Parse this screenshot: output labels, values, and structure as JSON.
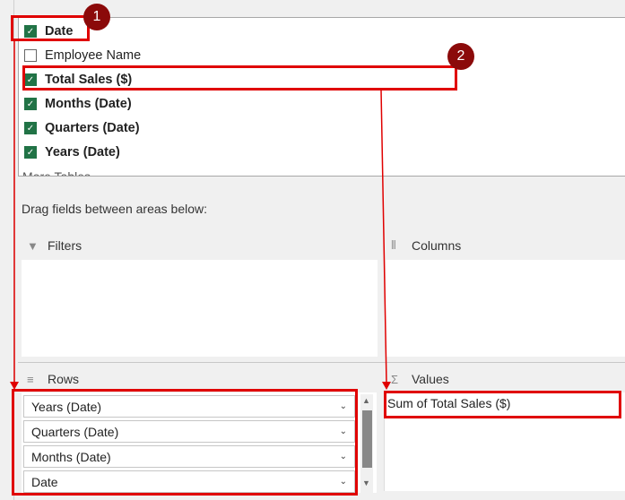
{
  "fields": [
    {
      "label": "Date",
      "checked": true
    },
    {
      "label": "Employee Name",
      "checked": false
    },
    {
      "label": "Total Sales ($)",
      "checked": true
    },
    {
      "label": "Months (Date)",
      "checked": true
    },
    {
      "label": "Quarters (Date)",
      "checked": true
    },
    {
      "label": "Years (Date)",
      "checked": true
    }
  ],
  "more_tables": "More Tables...",
  "drag_hint": "Drag fields between areas below:",
  "areas": {
    "filters": "Filters",
    "columns": "Columns",
    "rows": "Rows",
    "values": "Values"
  },
  "rows_items": [
    "Years (Date)",
    "Quarters (Date)",
    "Months (Date)",
    "Date"
  ],
  "values_items": [
    "Sum of Total Sales ($)"
  ],
  "annotations": {
    "step1": "1",
    "step2": "2"
  },
  "colors": {
    "accent": "#217346",
    "annotation": "#e00000",
    "badge": "#8b0a0a"
  }
}
